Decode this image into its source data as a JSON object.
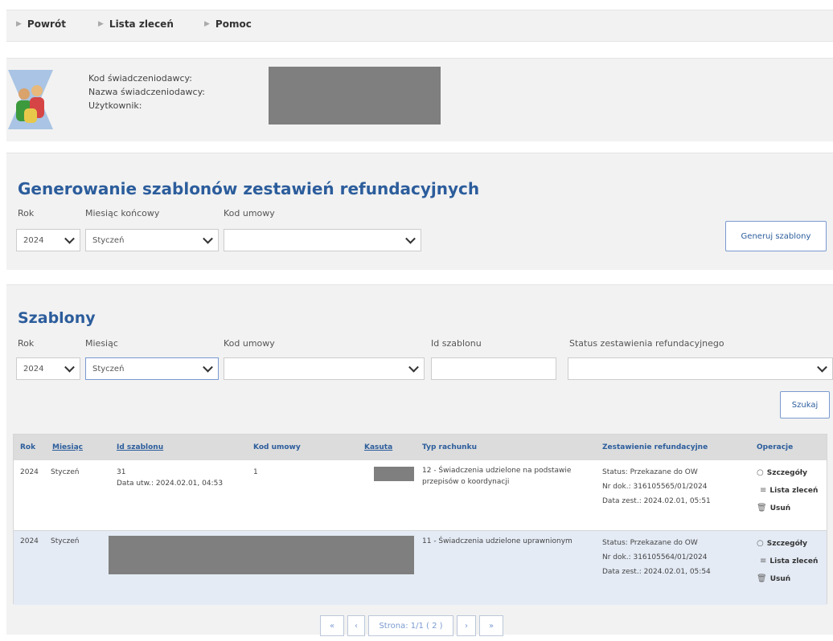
{
  "nav": {
    "items": [
      {
        "label": "Powrót"
      },
      {
        "label": "Lista zleceń"
      },
      {
        "label": "Pomoc"
      }
    ]
  },
  "user": {
    "labels": [
      "Kod świadczeniodawcy:",
      "Nazwa świadczeniodawcy:",
      "Użytkownik:"
    ]
  },
  "generator": {
    "title": "Generowanie szablonów zestawień refundacyjnych",
    "rok_label": "Rok",
    "rok_value": "2024",
    "miesiac_label": "Miesiąc końcowy",
    "miesiac_value": "Styczeń",
    "kod_label": "Kod umowy",
    "kod_value": "",
    "button": "Generuj szablony"
  },
  "templates": {
    "title": "Szablony",
    "rok_label": "Rok",
    "rok_value": "2024",
    "miesiac_label": "Miesiąc",
    "miesiac_value": "Styczeń",
    "kod_label": "Kod umowy",
    "id_label": "Id szablonu",
    "status_label": "Status zestawienia refundacyjnego",
    "search_button": "Szukaj"
  },
  "table": {
    "headers": [
      "Rok",
      "Miesiąc",
      "Id szablonu",
      "Kod umowy",
      "Kasuta",
      "Typ rachunku",
      "Zestawienie refundacyjne",
      "Operacje"
    ],
    "rows": [
      {
        "rok": "2024",
        "miesiac": "Styczeń",
        "id": "31",
        "id_date": "Data utw.: 2024.02.01, 04:53",
        "kod": "1",
        "typ_line1": "12 - Świadczenia udzielone na podstawie",
        "typ_line2": "przepisów o koordynacji",
        "status": "Status: Przekazane do OW",
        "nr": "Nr dok.: 316105565/01/2024",
        "data": "Data zest.: 2024.02.01, 05:51"
      },
      {
        "rok": "2024",
        "miesiac": "Styczeń",
        "typ_line1": "11 - Świadczenia udzielone uprawnionym",
        "status": "Status: Przekazane do OW",
        "nr": "Nr dok.: 316105564/01/2024",
        "data": "Data zest.: 2024.02.01, 05:54"
      }
    ],
    "ops": {
      "details": "Szczegóły",
      "orders": "Lista zleceń",
      "delete": "Usuń"
    }
  },
  "pager": {
    "first": "«",
    "prev": "‹",
    "page": "Strona: 1/1 ( 2 )",
    "next": "›",
    "last": "»"
  }
}
